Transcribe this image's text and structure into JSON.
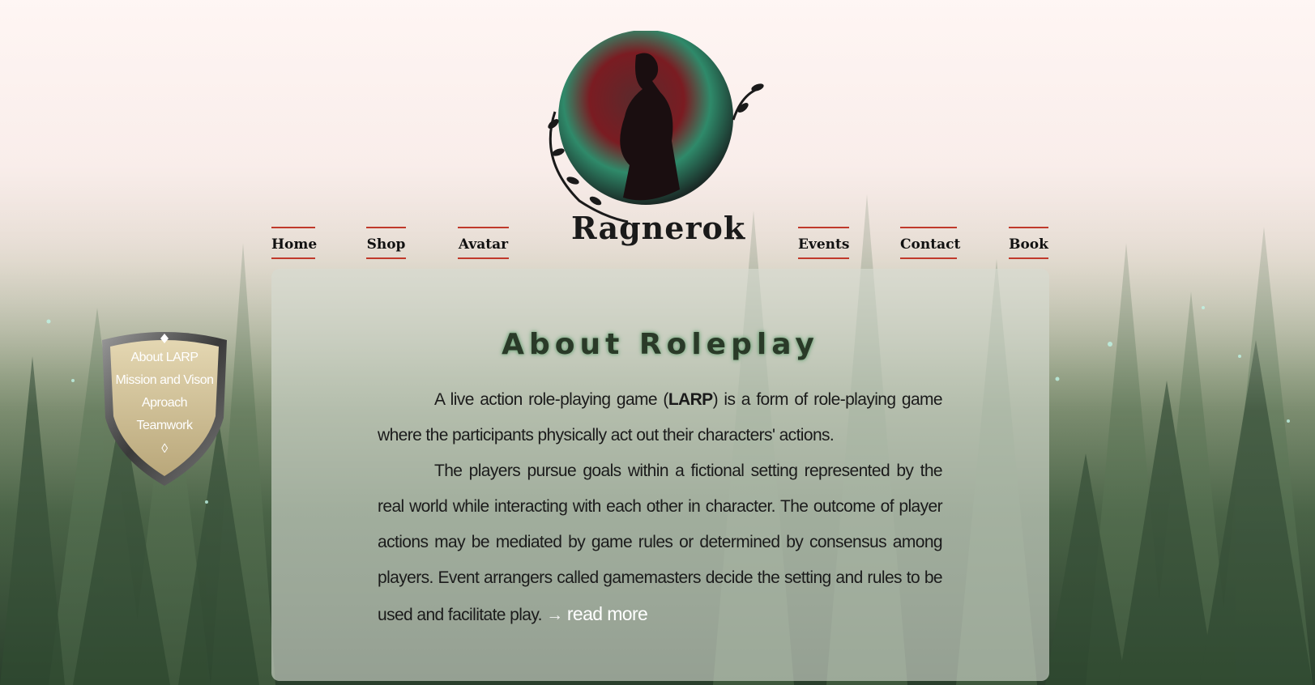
{
  "brand": {
    "name": "Ragnerok"
  },
  "nav": {
    "left": [
      "Home",
      "Shop",
      "Avatar"
    ],
    "right": [
      "Events",
      "Contact",
      "Book"
    ]
  },
  "side_menu": {
    "items": [
      "About LARP",
      "Mission and Vison",
      "Aproach",
      "Teamwork"
    ],
    "marker": "◊"
  },
  "content": {
    "title": "About Roleplay",
    "p1_before": "A live action role-playing game (",
    "p1_bold": "LARP",
    "p1_after": ") is a form of role-playing game where the participants physically act out their characters' actions.",
    "p2": "The players pursue goals within a fictional setting represented by the real world while interacting with each other in character. The outcome of player actions may be mediated by game rules or determined by consensus among players. Event arrangers called gamemasters decide the setting and rules to be used and facilitate play.",
    "arrow": "→",
    "read_more": "read more"
  },
  "colors": {
    "nav_border": "#c0392b",
    "title_glow": "#6aa377",
    "panel_bg": "rgba(215,220,210,0.62)"
  },
  "icons": [
    "forest-background",
    "warrior-logo-icon",
    "shield-icon",
    "diamond-icon"
  ]
}
